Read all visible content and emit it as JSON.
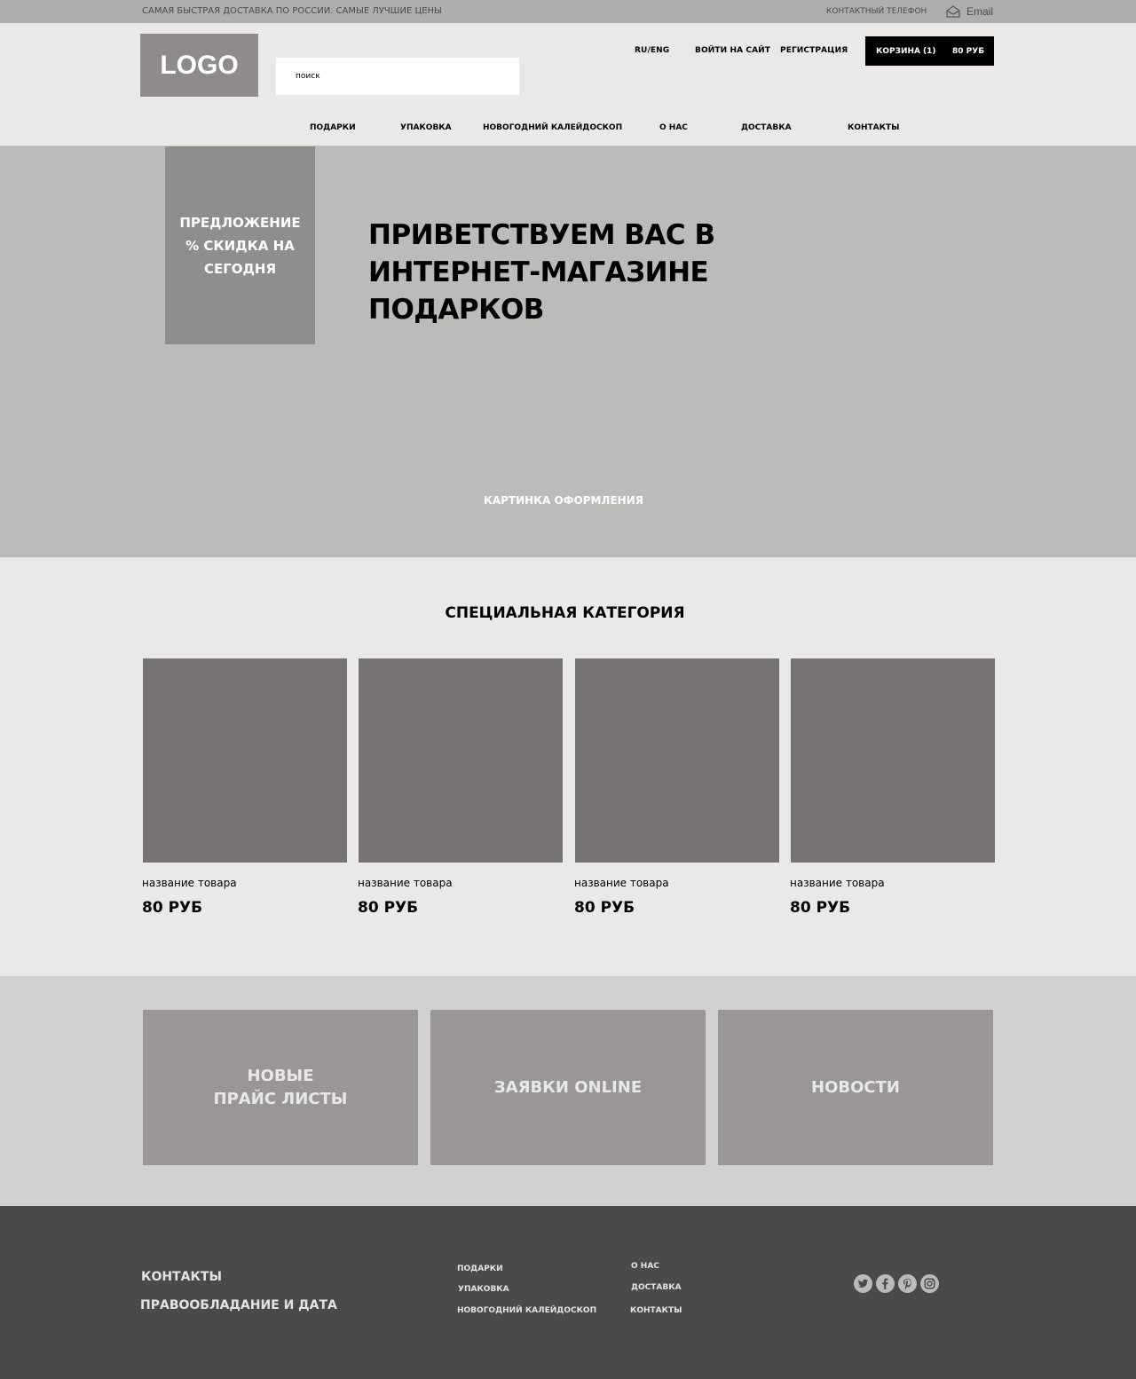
{
  "topbar": {
    "slogan": "САМАЯ БЫСТРАЯ ДОСТАВКА ПО РОССИИ. САМЫЕ ЛУЧШИЕ ЦЕНЫ",
    "phone_label": "КОНТАКТНЫЙ ТЕЛЕФОН",
    "email_label": "Email",
    "mail_icon": "envelope-icon"
  },
  "header": {
    "logo": "LOGO",
    "search_placeholder": "поиск",
    "lang": "RU/ENG",
    "login": "ВОЙТИ НА САЙТ",
    "register": "РЕГИСТРАЦИЯ",
    "cart": {
      "label": "КОРЗИНА",
      "count": "(1)",
      "total": "80 РУБ"
    }
  },
  "nav": [
    "ПОДАРКИ",
    "УПАКОВКА",
    "НОВОГОДНИЙ КАЛЕЙДОСКОП",
    "О НАС",
    "ДОСТАВКА",
    "КОНТАКТЫ"
  ],
  "hero": {
    "promo": "ПРЕДЛОЖЕНИЕ % СКИДКА НА СЕГОДНЯ",
    "title": "ПРИВЕТСТВУЕМ ВАС В ИНТЕРНЕТ-МАГАЗИНЕ ПОДАРКОВ",
    "caption": "КАРТИНКА ОФОРМЛЕНИЯ"
  },
  "special": {
    "title": "СПЕЦИАЛЬНАЯ КАТЕГОРИЯ",
    "products": [
      {
        "name": "название товара",
        "price": "80 РУБ"
      },
      {
        "name": "название товара",
        "price": "80 РУБ"
      },
      {
        "name": "название товара",
        "price": "80 РУБ"
      },
      {
        "name": "название товара",
        "price": "80 РУБ"
      }
    ]
  },
  "tiles": [
    "НОВЫЕ\nПРАЙС  ЛИСТЫ",
    "ЗАЯВКИ ONLINE",
    "НОВОСТИ"
  ],
  "footer": {
    "contacts": "КОНТАКТЫ",
    "copyright": "ПРАВООБЛАДАНИЕ И ДАТА",
    "col1": [
      "ПОДАРКИ",
      "УПАКОВКА",
      "НОВОГОДНИЙ КАЛЕЙДОСКОП"
    ],
    "col2": [
      "О НАС",
      "ДОСТАВКА",
      "КОНТАКТЫ"
    ],
    "social_icons": [
      "twitter-icon",
      "facebook-icon",
      "pinterest-icon",
      "instagram-icon"
    ]
  },
  "colors": {
    "topbar": "#b0adad",
    "page": "#ebe8e8",
    "hero": "#bdbaba",
    "product_image": "#777373",
    "tile": "#9a9696",
    "footer": "#4a4a4a",
    "cart": "#000000"
  }
}
